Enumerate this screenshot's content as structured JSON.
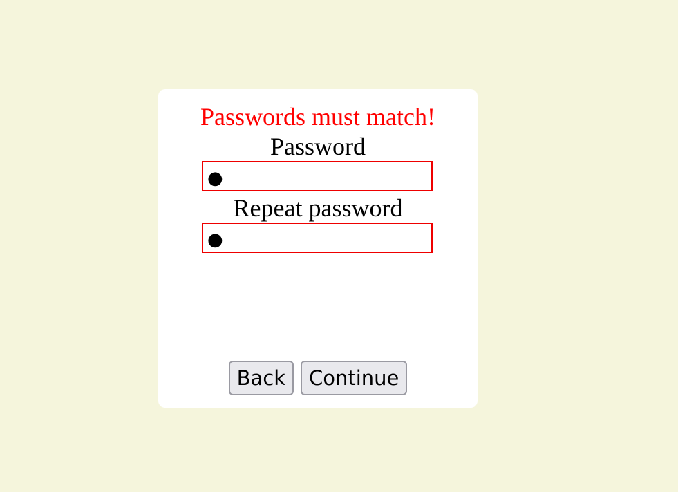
{
  "form": {
    "error_message": "Passwords must match!",
    "password_label": "Password",
    "password_value": "●",
    "repeat_label": "Repeat password",
    "repeat_value": "●"
  },
  "buttons": {
    "back_label": "Back",
    "continue_label": "Continue"
  },
  "colors": {
    "page_background": "#f5f5dc",
    "card_background": "#ffffff",
    "error_text": "#ff0000",
    "field_border_error": "#ee0000",
    "button_background": "#e9e9ed"
  }
}
